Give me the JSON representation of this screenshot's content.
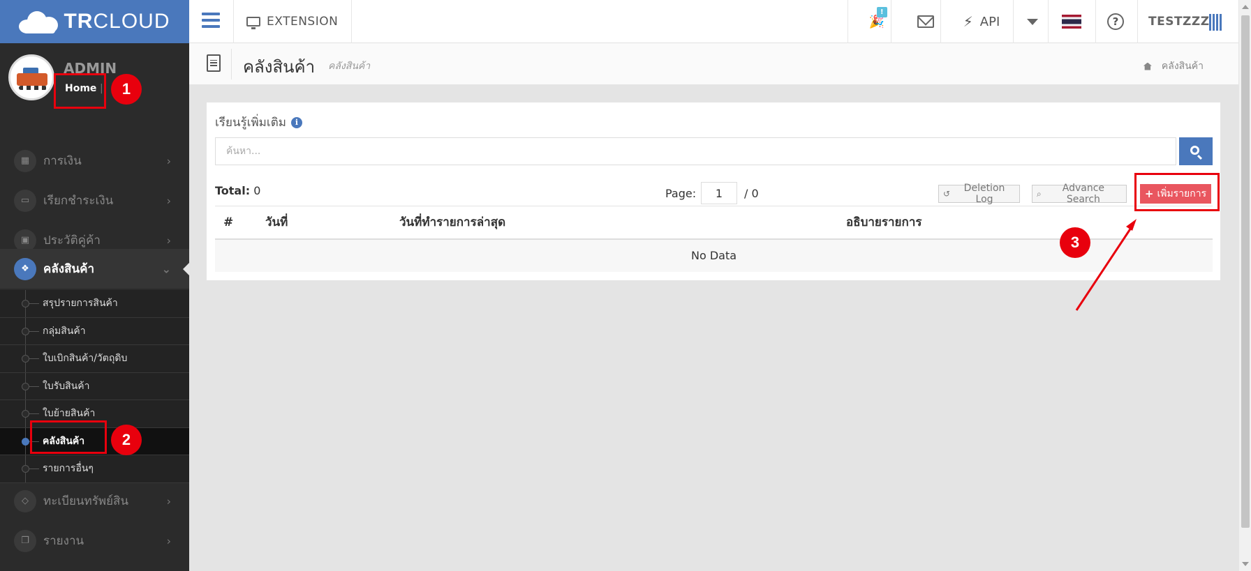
{
  "sidebar": {
    "brand_bold": "TR",
    "brand_rest": "CLOUD",
    "admin_name": "ADMIN",
    "home_link": "Home",
    "home_separator": "|",
    "items": [
      {
        "label": "การเงิน",
        "icon": "calendar-icon"
      },
      {
        "label": "เรียกชำระเงิน",
        "icon": "credit-card-icon"
      },
      {
        "label": "ประวัติคู่ค้า",
        "icon": "contact-book-icon"
      },
      {
        "label": "คลังสินค้า",
        "icon": "cubes-icon",
        "active": true
      },
      {
        "label": "ทะเบียนทรัพย์สิน",
        "icon": "diamond-icon"
      },
      {
        "label": "รายงาน",
        "icon": "clone-icon"
      }
    ],
    "sub_items": [
      {
        "label": "สรุปรายการสินค้า"
      },
      {
        "label": "กลุ่มสินค้า"
      },
      {
        "label": "ใบเบิกสินค้า/วัตถุดิบ"
      },
      {
        "label": "ใบรับสินค้า"
      },
      {
        "label": "ใบย้ายสินค้า"
      },
      {
        "label": "คลังสินค้า",
        "current": true
      },
      {
        "label": "รายการอื่นๆ"
      }
    ]
  },
  "topbar": {
    "extension_label": "EXTENSION",
    "notification_count": "!",
    "api_label": "API",
    "user_name": "TESTZZZ"
  },
  "page": {
    "title": "คลังสินค้า",
    "subtitle": "คลังสินค้า",
    "breadcrumb": "คลังสินค้า"
  },
  "panel": {
    "learn_more": "เรียนรู้เพิ่มเติม",
    "search_placeholder": "ค้นหา...",
    "total_label": "Total:",
    "total_value": "0",
    "page_label": "Page:",
    "page_value": "1",
    "page_total": "/ 0",
    "deletion_log": "Deletion Log",
    "advance_search": "Advance Search",
    "add_label": "เพิ่มรายการ",
    "columns": [
      "#",
      "วันที่",
      "วันที่ทำรายการล่าสุด",
      "อธิบายรายการ"
    ],
    "empty_text": "No Data"
  },
  "annotations": [
    "1",
    "2",
    "3"
  ],
  "colors": {
    "brand_blue": "#4a78bc",
    "sidebar_bg": "#2b2b2b",
    "add_button": "#e9565f",
    "annotation_red": "#e8000d"
  }
}
